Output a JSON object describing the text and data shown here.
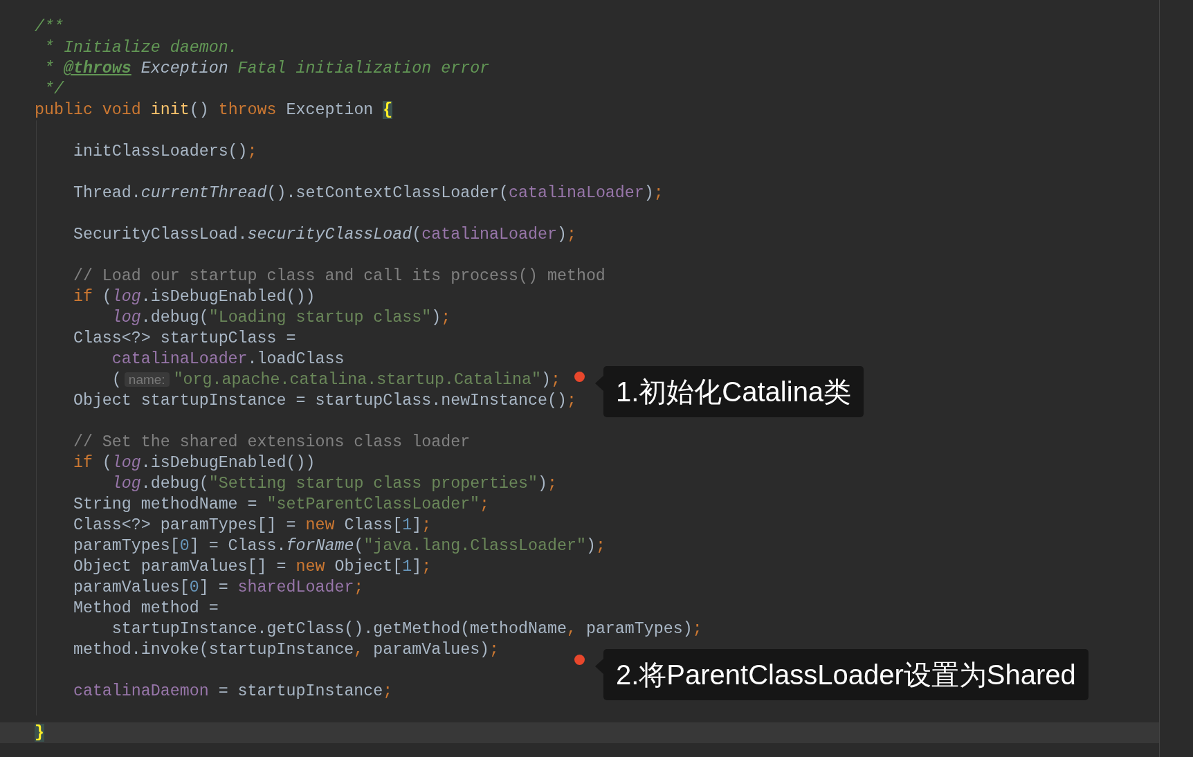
{
  "editor": {
    "lines": [
      {
        "current": false,
        "tokens": [
          {
            "text": "/**",
            "kind": "doc"
          }
        ]
      },
      {
        "current": false,
        "tokens": [
          {
            "text": " * Initialize daemon.",
            "kind": "doc"
          }
        ]
      },
      {
        "current": false,
        "tokens": [
          {
            "text": " * ",
            "kind": "doc"
          },
          {
            "text": "@throws",
            "kind": "doc-tag"
          },
          {
            "text": " Exception",
            "kind": "doc-ref"
          },
          {
            "text": " Fatal initialization error",
            "kind": "doc"
          }
        ]
      },
      {
        "current": false,
        "tokens": [
          {
            "text": " */",
            "kind": "doc"
          }
        ]
      },
      {
        "current": false,
        "tokens": [
          {
            "text": "public void",
            "kind": "keyword"
          },
          {
            "text": " init",
            "kind": "declaration"
          },
          {
            "text": "() ",
            "kind": "plain"
          },
          {
            "text": "throws",
            "kind": "keyword"
          },
          {
            "text": " Exception ",
            "kind": "plain"
          },
          {
            "text": "{",
            "kind": "matched-brace"
          }
        ]
      },
      {
        "current": false
      },
      {
        "current": false,
        "tokens": [
          {
            "text": "    initClassLoaders()",
            "kind": "plain"
          },
          {
            "text": ";",
            "kind": "keyword"
          }
        ]
      },
      {
        "current": false
      },
      {
        "current": false,
        "tokens": [
          {
            "text": "    Thread.",
            "kind": "plain"
          },
          {
            "text": "currentThread",
            "kind": "static-call"
          },
          {
            "text": "().setContextClassLoader(",
            "kind": "plain"
          },
          {
            "text": "catalinaLoader",
            "kind": "field"
          },
          {
            "text": ")",
            "kind": "plain"
          },
          {
            "text": ";",
            "kind": "keyword"
          }
        ]
      },
      {
        "current": false
      },
      {
        "current": false,
        "tokens": [
          {
            "text": "    SecurityClassLoad.",
            "kind": "plain"
          },
          {
            "text": "securityClassLoad",
            "kind": "static-call"
          },
          {
            "text": "(",
            "kind": "plain"
          },
          {
            "text": "catalinaLoader",
            "kind": "field"
          },
          {
            "text": ")",
            "kind": "plain"
          },
          {
            "text": ";",
            "kind": "keyword"
          }
        ]
      },
      {
        "current": false
      },
      {
        "current": false,
        "tokens": [
          {
            "text": "    // Load our startup class and call its process() method",
            "kind": "comment"
          }
        ]
      },
      {
        "current": false,
        "tokens": [
          {
            "text": "    if",
            "kind": "keyword"
          },
          {
            "text": " (",
            "kind": "plain"
          },
          {
            "text": "log",
            "kind": "static-field"
          },
          {
            "text": ".isDebugEnabled())",
            "kind": "plain"
          }
        ]
      },
      {
        "current": false,
        "tokens": [
          {
            "text": "        log",
            "kind": "static-field"
          },
          {
            "text": ".debug(",
            "kind": "plain"
          },
          {
            "text": "\"Loading startup class\"",
            "kind": "string"
          },
          {
            "text": ")",
            "kind": "plain"
          },
          {
            "text": ";",
            "kind": "keyword"
          }
        ]
      },
      {
        "current": false,
        "tokens": [
          {
            "text": "    Class<?> startupClass =",
            "kind": "plain"
          }
        ]
      },
      {
        "current": false,
        "tokens": [
          {
            "text": "        catalinaLoader",
            "kind": "field"
          },
          {
            "text": ".loadClass",
            "kind": "plain"
          }
        ]
      },
      {
        "current": false,
        "tokens": [
          {
            "text": "        (",
            "kind": "plain"
          },
          {
            "text": "name:",
            "kind": "hint"
          },
          {
            "text": "\"org.apache.catalina.startup.Catalina\"",
            "kind": "string"
          },
          {
            "text": ")",
            "kind": "plain"
          },
          {
            "text": ";",
            "kind": "keyword"
          }
        ],
        "annotation": "1.初始化Catalina类"
      },
      {
        "current": false,
        "tokens": [
          {
            "text": "    Object startupInstance = startupClass.newInstance()",
            "kind": "plain"
          },
          {
            "text": ";",
            "kind": "keyword"
          }
        ]
      },
      {
        "current": false
      },
      {
        "current": false,
        "tokens": [
          {
            "text": "    // Set the shared extensions class loader",
            "kind": "comment"
          }
        ]
      },
      {
        "current": false,
        "tokens": [
          {
            "text": "    if",
            "kind": "keyword"
          },
          {
            "text": " (",
            "kind": "plain"
          },
          {
            "text": "log",
            "kind": "static-field"
          },
          {
            "text": ".isDebugEnabled())",
            "kind": "plain"
          }
        ]
      },
      {
        "current": false,
        "tokens": [
          {
            "text": "        log",
            "kind": "static-field"
          },
          {
            "text": ".debug(",
            "kind": "plain"
          },
          {
            "text": "\"Setting startup class properties\"",
            "kind": "string"
          },
          {
            "text": ")",
            "kind": "plain"
          },
          {
            "text": ";",
            "kind": "keyword"
          }
        ]
      },
      {
        "current": false,
        "tokens": [
          {
            "text": "    String methodName = ",
            "kind": "plain"
          },
          {
            "text": "\"setParentClassLoader\"",
            "kind": "string"
          },
          {
            "text": ";",
            "kind": "keyword"
          }
        ]
      },
      {
        "current": false,
        "tokens": [
          {
            "text": "    Class<?> paramTypes[] = ",
            "kind": "plain"
          },
          {
            "text": "new",
            "kind": "keyword"
          },
          {
            "text": " Class[",
            "kind": "plain"
          },
          {
            "text": "1",
            "kind": "number"
          },
          {
            "text": "]",
            "kind": "plain"
          },
          {
            "text": ";",
            "kind": "keyword"
          }
        ]
      },
      {
        "current": false,
        "tokens": [
          {
            "text": "    paramTypes[",
            "kind": "plain"
          },
          {
            "text": "0",
            "kind": "number"
          },
          {
            "text": "] = Class.",
            "kind": "plain"
          },
          {
            "text": "forName",
            "kind": "static-call"
          },
          {
            "text": "(",
            "kind": "plain"
          },
          {
            "text": "\"java.lang.ClassLoader\"",
            "kind": "string"
          },
          {
            "text": ")",
            "kind": "plain"
          },
          {
            "text": ";",
            "kind": "keyword"
          }
        ]
      },
      {
        "current": false,
        "tokens": [
          {
            "text": "    Object paramValues[] = ",
            "kind": "plain"
          },
          {
            "text": "new",
            "kind": "keyword"
          },
          {
            "text": " Object[",
            "kind": "plain"
          },
          {
            "text": "1",
            "kind": "number"
          },
          {
            "text": "]",
            "kind": "plain"
          },
          {
            "text": ";",
            "kind": "keyword"
          }
        ]
      },
      {
        "current": false,
        "tokens": [
          {
            "text": "    paramValues[",
            "kind": "plain"
          },
          {
            "text": "0",
            "kind": "number"
          },
          {
            "text": "] = ",
            "kind": "plain"
          },
          {
            "text": "sharedLoader",
            "kind": "field"
          },
          {
            "text": ";",
            "kind": "keyword"
          }
        ]
      },
      {
        "current": false,
        "tokens": [
          {
            "text": "    Method method =",
            "kind": "plain"
          }
        ]
      },
      {
        "current": false,
        "tokens": [
          {
            "text": "        startupInstance.getClass().getMethod(methodName",
            "kind": "plain"
          },
          {
            "text": ",",
            "kind": "keyword"
          },
          {
            "text": " paramTypes)",
            "kind": "plain"
          },
          {
            "text": ";",
            "kind": "keyword"
          }
        ]
      },
      {
        "current": false,
        "tokens": [
          {
            "text": "    method.invoke(startupInstance",
            "kind": "plain"
          },
          {
            "text": ",",
            "kind": "keyword"
          },
          {
            "text": " paramValues)",
            "kind": "plain"
          },
          {
            "text": ";",
            "kind": "keyword"
          }
        ],
        "annotation": "2.将ParentClassLoader设置为Shared"
      },
      {
        "current": false
      },
      {
        "current": false,
        "tokens": [
          {
            "text": "    catalinaDaemon",
            "kind": "field"
          },
          {
            "text": " = startupInstance",
            "kind": "plain"
          },
          {
            "text": ";",
            "kind": "keyword"
          }
        ]
      },
      {
        "current": false
      },
      {
        "current": true,
        "tokens": [
          {
            "text": "}",
            "kind": "matched-brace"
          }
        ]
      }
    ]
  }
}
